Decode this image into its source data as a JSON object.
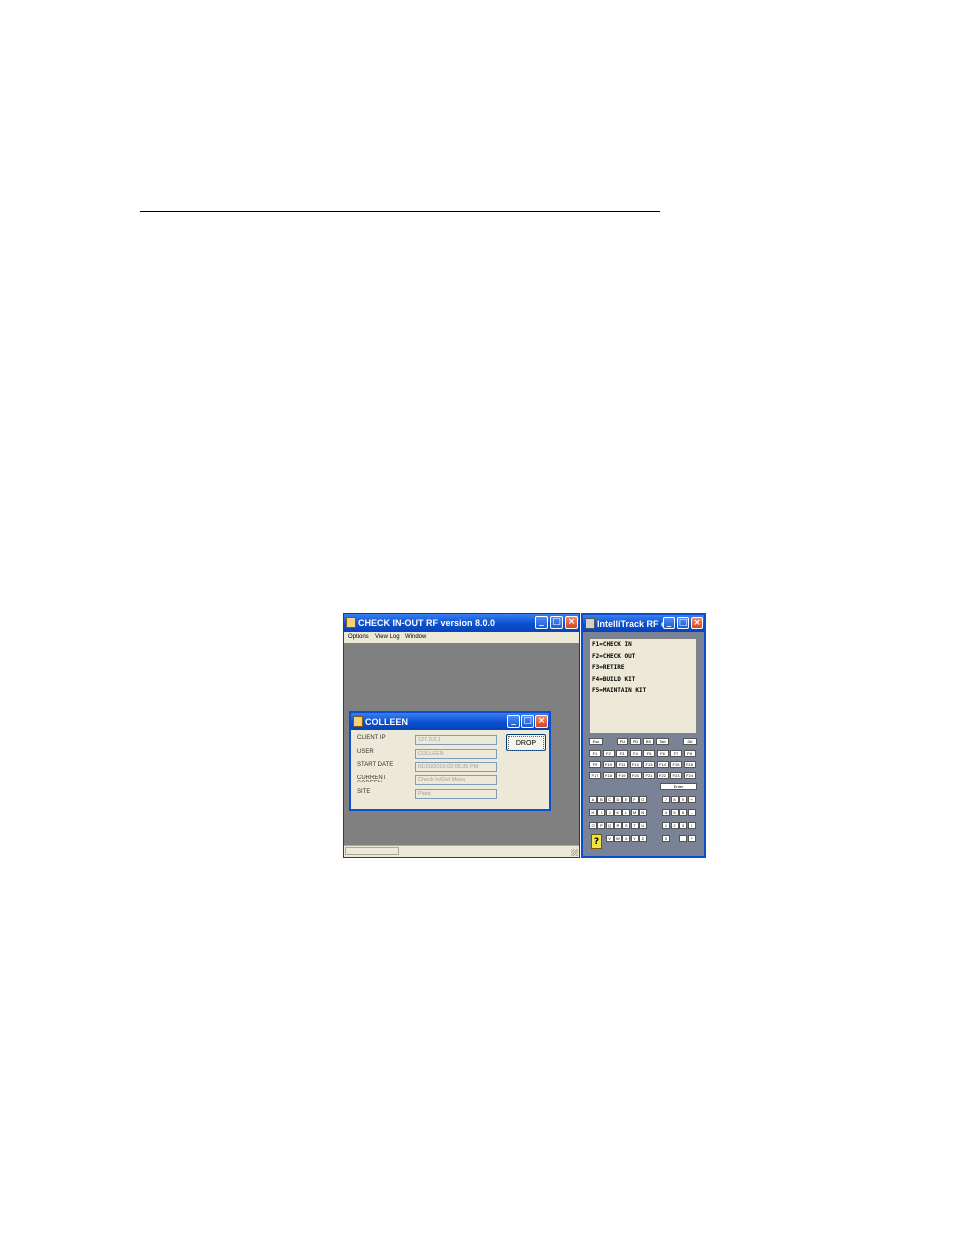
{
  "main_window": {
    "title": "CHECK IN-OUT RF version 8.0.0",
    "menu": [
      "Options",
      "View Log",
      "Window"
    ]
  },
  "dialog": {
    "title": "COLLEEN",
    "fields": [
      {
        "label": "CLIENT IP",
        "value": "127.0.0.1"
      },
      {
        "label": "USER",
        "value": "COLLEEN"
      },
      {
        "label": "START DATE",
        "value": "01/20/2010 02:05:35 PM"
      },
      {
        "label": "CURRENT SCREEN",
        "value": "Check In/Out Menu"
      },
      {
        "label": "SITE",
        "value": "Plant"
      }
    ],
    "drop_label": "DROP"
  },
  "rf_window": {
    "title": "IntelliTrack RF c...",
    "screen_lines": [
      "F1=CHECK IN",
      "F2=CHECK OUT",
      "F3=RETIRE",
      "F4=BUILD KIT",
      "F5=MAINTAIN KIT"
    ],
    "keys_top": [
      "Esc",
      "PU",
      "PD",
      "BS",
      "Tab",
      "Dlt"
    ],
    "fkeys_row1": [
      "F1",
      "F2",
      "F3",
      "F4",
      "F5",
      "F6",
      "F7",
      "F8"
    ],
    "fkeys_row2": [
      "F9",
      "F10",
      "F11",
      "F12",
      "F13",
      "F14",
      "F15",
      "F16"
    ],
    "fkeys_row3": [
      "F17",
      "F18",
      "F19",
      "F20",
      "F21",
      "F22",
      "F23",
      "F24"
    ],
    "enter_label": "Enter",
    "alpha_rows": [
      [
        "A",
        "B",
        "C",
        "D",
        "E",
        "F",
        "G"
      ],
      [
        "H",
        "I",
        "J",
        "K",
        "L",
        "M",
        "N"
      ],
      [
        "O",
        "P",
        "Q",
        "R",
        "S",
        "T",
        "U"
      ],
      [
        "V",
        "W",
        "X",
        "Y",
        "Z"
      ]
    ],
    "num_rows": [
      [
        "7",
        "8",
        "9",
        "+"
      ],
      [
        "4",
        "5",
        "6",
        "-"
      ],
      [
        "1",
        "2",
        "3",
        "/"
      ],
      [
        "0",
        ".",
        "*"
      ]
    ],
    "help_icon": "?"
  }
}
